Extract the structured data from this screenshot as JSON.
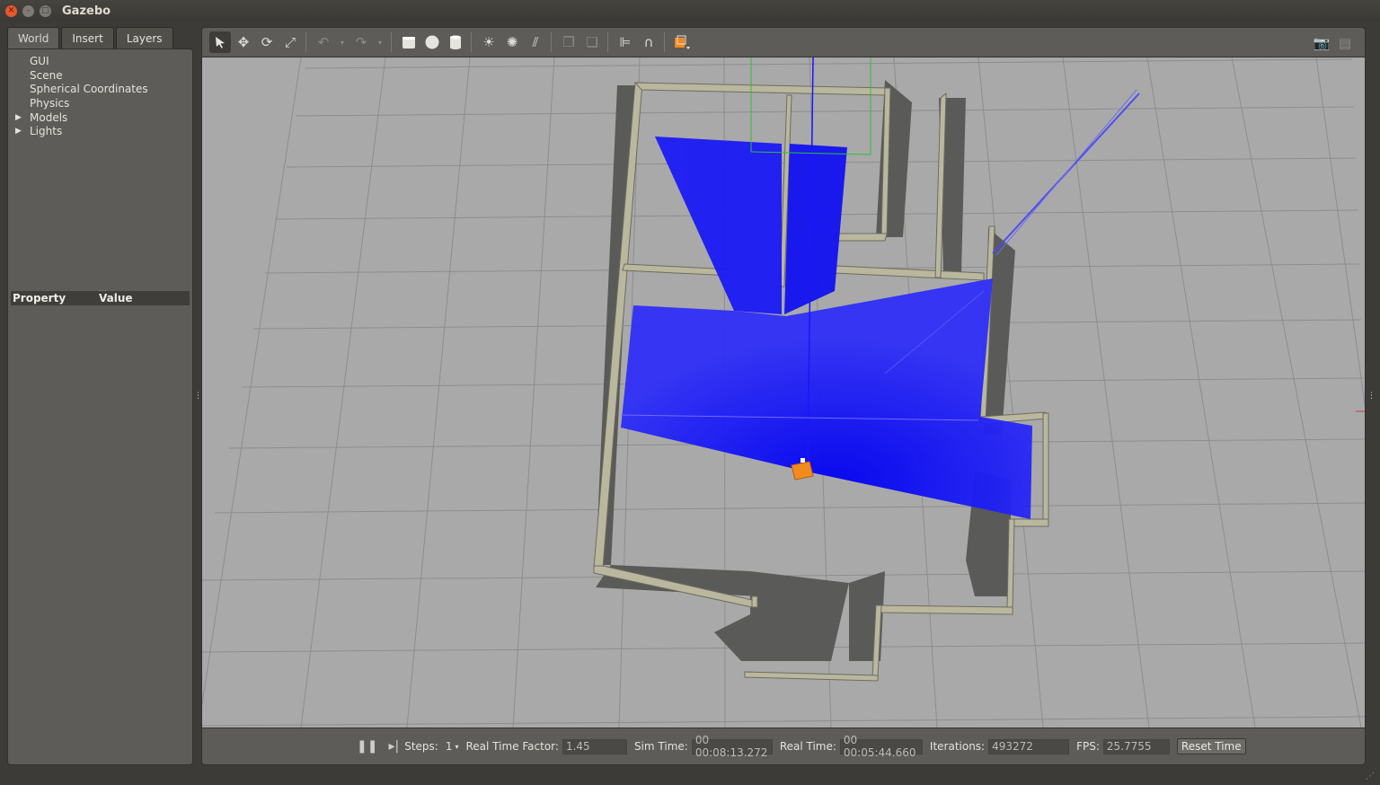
{
  "window": {
    "title": "Gazebo"
  },
  "left_panel": {
    "tabs": [
      {
        "label": "World"
      },
      {
        "label": "Insert"
      },
      {
        "label": "Layers"
      }
    ],
    "tree": [
      {
        "label": "GUI",
        "expandable": false
      },
      {
        "label": "Scene",
        "expandable": false
      },
      {
        "label": "Spherical Coordinates",
        "expandable": false
      },
      {
        "label": "Physics",
        "expandable": false
      },
      {
        "label": "Models",
        "expandable": true
      },
      {
        "label": "Lights",
        "expandable": true
      }
    ],
    "property_table": {
      "col_property": "Property",
      "col_value": "Value"
    }
  },
  "toolbar": {
    "icons": [
      "select-icon",
      "translate-icon",
      "rotate-icon",
      "scale-icon",
      "undo-icon",
      "undo-dropdown-icon",
      "redo-icon",
      "redo-dropdown-icon",
      "box-icon",
      "sphere-icon",
      "cylinder-icon",
      "point-light-icon",
      "spot-light-icon",
      "directional-light-icon",
      "copy-icon",
      "paste-icon",
      "align-icon",
      "snap-icon",
      "view-angle-icon",
      "screenshot-icon",
      "log-icon"
    ]
  },
  "statusbar": {
    "steps_label": "Steps:",
    "steps_value": "1",
    "rtf_label": "Real Time Factor:",
    "rtf_value": "1.45",
    "sim_time_label": "Sim Time:",
    "sim_time_value": "00 00:08:13.272",
    "real_time_label": "Real Time:",
    "real_time_value": "00 00:05:44.660",
    "iterations_label": "Iterations:",
    "iterations_value": "493272",
    "fps_label": "FPS:",
    "fps_value": "25.7755",
    "reset_label": "Reset Time"
  },
  "colors": {
    "laser": "#1010ff",
    "wall": "#b9b89f",
    "ground": "#a9a9a9",
    "robot": "#f28a1e"
  }
}
